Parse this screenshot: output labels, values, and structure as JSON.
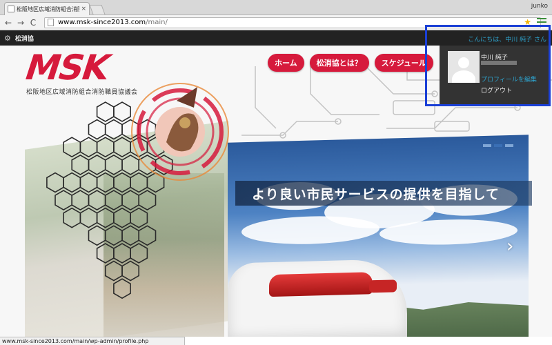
{
  "browser": {
    "tab_title": "松阪地区広域消防組合消防職員協",
    "tab_close": "×",
    "profile_name": "junko",
    "back_icon": "←",
    "forward_icon": "→",
    "reload_icon": "C",
    "url_host": "www.msk-since2013.com",
    "url_path": "/main/",
    "star_icon": "★"
  },
  "adminbar": {
    "site_icon": "⚙",
    "site_name": "松消協",
    "greeting": "こんにちは、中川 純子 さん"
  },
  "account_menu": {
    "display_name": "中川 純子",
    "edit_profile": "プロフィールを編集",
    "logout": "ログアウト"
  },
  "site": {
    "logo_text": "MSK",
    "logo_subtitle": "松阪地区広域消防組合消防職員協議会",
    "nav": [
      {
        "label": "ホーム"
      },
      {
        "label": "松消協とは？"
      },
      {
        "label": "スケジュール"
      }
    ],
    "tagline": "より良い市民サービスの提供を目指して",
    "next_icon": "›"
  },
  "status_url": "www.msk-since2013.com/main/wp-admin/profile.php",
  "colors": {
    "brand_red": "#d61a3c",
    "admin_bg": "#222222",
    "link_blue": "#2ea2cc",
    "highlight": "#1a3fd6"
  }
}
